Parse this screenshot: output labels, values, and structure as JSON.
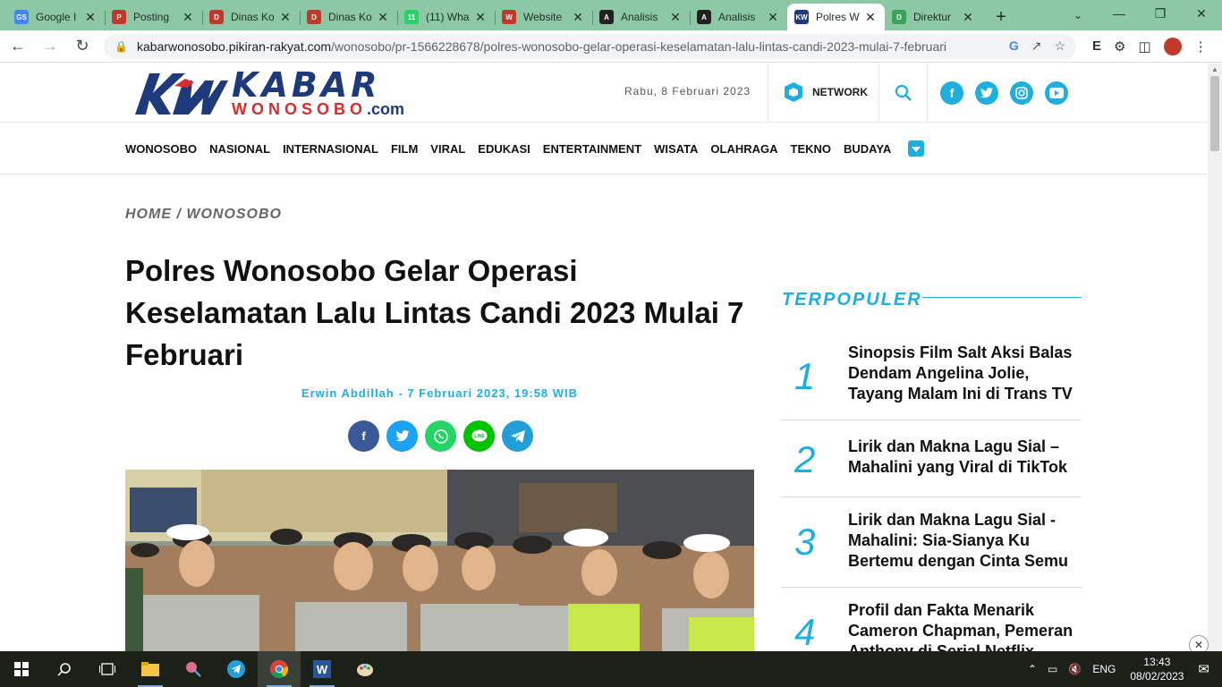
{
  "browser": {
    "tabs": [
      {
        "title": "Google I",
        "favicon_color": "#4285f4",
        "favicon_text": "GS"
      },
      {
        "title": "Posting",
        "favicon_color": "#c0392b",
        "favicon_text": "P"
      },
      {
        "title": "Dinas Ko",
        "favicon_color": "#c0392b",
        "favicon_text": "D"
      },
      {
        "title": "Dinas Ko",
        "favicon_color": "#c0392b",
        "favicon_text": "D"
      },
      {
        "title": "(11) Wha",
        "favicon_color": "#25d366",
        "favicon_text": "11"
      },
      {
        "title": "Website",
        "favicon_color": "#c0392b",
        "favicon_text": "W"
      },
      {
        "title": "Analisis",
        "favicon_color": "#222222",
        "favicon_text": "A"
      },
      {
        "title": "Analisis",
        "favicon_color": "#222222",
        "favicon_text": "A"
      },
      {
        "title": "Polres W",
        "favicon_color": "#1f3a7a",
        "favicon_text": "KW",
        "active": true
      },
      {
        "title": "Direktur",
        "favicon_color": "#3aa35a",
        "favicon_text": "D"
      }
    ],
    "new_tab": "+",
    "url_host": "kabarwonosobo.pikiran-rakyat.com",
    "url_path": "/wonosobo/pr-1566228678/polres-wonosobo-gelar-operasi-keselamatan-lalu-lintas-candi-2023-mulai-7-februari"
  },
  "header": {
    "logo_main": "KABAR",
    "logo_sub": "WONOSOBO",
    "logo_com": ".com",
    "date": "Rabu, 8 Februari 2023",
    "network_label": "NETWORK",
    "social": [
      "f",
      "t",
      "ig",
      "yt"
    ]
  },
  "nav": {
    "items": [
      "WONOSOBO",
      "NASIONAL",
      "INTERNASIONAL",
      "FILM",
      "VIRAL",
      "EDUKASI",
      "ENTERTAINMENT",
      "WISATA",
      "OLAHRAGA",
      "TEKNO",
      "BUDAYA"
    ]
  },
  "article": {
    "breadcrumb": "HOME / WONOSOBO",
    "headline": "Polres Wonosobo Gelar Operasi Keselamatan Lalu Lintas Candi 2023 Mulai 7 Februari",
    "author": "Erwin Abdillah",
    "byline_rest": " - 7 Februari 2023, 19:58 WIB"
  },
  "sidebar": {
    "title": "TERPOPULER",
    "items": [
      {
        "num": "1",
        "text": "Sinopsis Film Salt Aksi Balas Dendam Angelina Jolie, Tayang Malam Ini di Trans TV"
      },
      {
        "num": "2",
        "text": "Lirik dan Makna Lagu Sial – Mahalini yang Viral di TikTok"
      },
      {
        "num": "3",
        "text": "Lirik dan Makna Lagu Sial - Mahalini: Sia-Sianya Ku Bertemu dengan Cinta Semu"
      },
      {
        "num": "4",
        "text": "Profil dan Fakta Menarik Cameron Chapman, Pemeran Anthony di Serial Netflix"
      }
    ]
  },
  "taskbar": {
    "lang": "ENG",
    "time": "13:43",
    "date": "08/02/2023"
  },
  "colors": {
    "accent": "#1eaee0",
    "brand_navy": "#1f3a7a",
    "brand_red": "#d32f2f",
    "tabbar": "#8cc8a6"
  }
}
